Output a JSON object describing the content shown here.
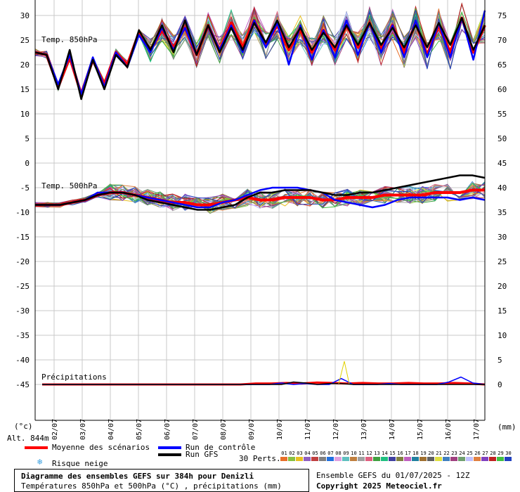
{
  "chart_data": {
    "type": "line",
    "title": "Diagramme des ensembles GEFS sur 384h pour Denizli",
    "subtitle": "Températures 850hPa et 500hPa (°C) , précipitations (mm)",
    "dates": [
      "02/07",
      "03/07",
      "04/07",
      "05/07",
      "06/07",
      "07/07",
      "08/07",
      "09/07",
      "10/07",
      "11/07",
      "12/07",
      "13/07",
      "14/07",
      "15/07",
      "16/07",
      "17/07"
    ],
    "left_axis_ticks": [
      "30",
      "25",
      "20",
      "15",
      "10",
      "5",
      "0",
      "-5",
      "-10",
      "-15",
      "-20",
      "-25",
      "-30",
      "-35",
      "-40",
      "-45"
    ],
    "right_axis_ticks": [
      "75",
      "70",
      "65",
      "60",
      "55",
      "50",
      "45",
      "40",
      "35",
      "30",
      "25",
      "20",
      "15",
      "10",
      "5",
      "0"
    ],
    "left_unit": "(°c)",
    "right_unit": "(mm)",
    "altitude": "Alt. 844m",
    "panels": [
      {
        "label": "Temp. 850hPa",
        "ylim": [
          0,
          33
        ]
      },
      {
        "label": "Temp. 500hPa",
        "ylim": [
          -50,
          0
        ]
      },
      {
        "label": "Précipitations",
        "ylim": [
          0,
          45
        ]
      }
    ],
    "series": [
      {
        "name": "Moyenne des scénarios",
        "color": "#ff0000",
        "t850": [
          22.5,
          22,
          15.5,
          21.5,
          14,
          21,
          16,
          22.5,
          20,
          26.5,
          23,
          27,
          23.5,
          27.5,
          22,
          28,
          23,
          28.5,
          23.5,
          29,
          24,
          28,
          23,
          27,
          22.5,
          27,
          23,
          28,
          23.5,
          28.5,
          23,
          28,
          22.5,
          28.5,
          22,
          28,
          22.5,
          29.5,
          22.5,
          28
        ],
        "t500": [
          -8.5,
          -8.5,
          -8.5,
          -8,
          -7.5,
          -6.5,
          -6,
          -6,
          -6.5,
          -7,
          -7.5,
          -8,
          -8,
          -8.5,
          -8.5,
          -8,
          -7.5,
          -7,
          -7.5,
          -7.5,
          -7,
          -7,
          -7,
          -7.5,
          -7.5,
          -7,
          -7,
          -7,
          -6.5,
          -6.5,
          -6.5,
          -6.5,
          -6,
          -6,
          -6,
          -5.5,
          -5.5
        ],
        "precip": [
          0,
          0,
          0,
          0,
          0,
          0,
          0,
          0,
          0,
          0,
          0,
          0,
          0,
          0,
          0.2,
          0.2,
          0.3,
          0.2,
          0.4,
          0.3,
          0.2,
          0.3,
          0.2,
          0.2,
          0.3,
          0.2,
          0.2,
          0.3,
          0.2,
          0
        ]
      },
      {
        "name": "Run de contrôle",
        "color": "#0000ff",
        "t850": [
          22.5,
          22,
          16,
          22,
          14,
          21.5,
          15.5,
          22.5,
          19.5,
          26,
          22.5,
          27.5,
          23,
          27.5,
          22,
          28,
          23,
          28,
          22.5,
          29,
          23.5,
          28.5,
          20,
          28,
          21,
          27,
          21.5,
          29,
          22,
          28.5,
          22.5,
          28,
          21.5,
          29,
          21.5,
          28.5,
          21.5,
          29.5,
          21,
          31
        ],
        "t500": [
          -8.5,
          -8.5,
          -8.5,
          -8,
          -7.5,
          -6,
          -6,
          -6,
          -6.5,
          -7,
          -7.5,
          -8,
          -8.5,
          -9,
          -9,
          -8,
          -7.5,
          -6.5,
          -5.5,
          -5,
          -5,
          -5,
          -5.5,
          -6,
          -7.5,
          -8,
          -8.5,
          -9,
          -8.5,
          -7.5,
          -7,
          -7,
          -7,
          -7,
          -7.5,
          -7,
          -7.5
        ],
        "precip": [
          0,
          0,
          0,
          0,
          0,
          0,
          0,
          0,
          0,
          0,
          0,
          0,
          0,
          0,
          0,
          0,
          0,
          0,
          0,
          0,
          0.3,
          0,
          0.2,
          0,
          0,
          1.2,
          0,
          0,
          0,
          0.2,
          0,
          0,
          0,
          0,
          0.5,
          1.5,
          0.3,
          0
        ]
      },
      {
        "name": "Run GFS",
        "color": "#000000",
        "t850": [
          22.5,
          22,
          15,
          23,
          13,
          21,
          15,
          22,
          19.5,
          27,
          23,
          28,
          22.5,
          29,
          22,
          28,
          22.5,
          27.5,
          23,
          28.5,
          24.5,
          29,
          23.5,
          27.5,
          23,
          26.5,
          23.5,
          28,
          24,
          28.5,
          24,
          27.5,
          23.5,
          28,
          23.5,
          28.5,
          24,
          29.5,
          23,
          28
        ],
        "t500": [
          -8.5,
          -8.5,
          -8.5,
          -8,
          -7.5,
          -6.5,
          -6,
          -6,
          -6.5,
          -7.5,
          -8,
          -8.5,
          -9,
          -9.5,
          -9.5,
          -9,
          -8.5,
          -7,
          -6,
          -6,
          -5.5,
          -5.5,
          -5.5,
          -6,
          -6.5,
          -6.5,
          -6,
          -6,
          -5.5,
          -5,
          -4.5,
          -4,
          -3.5,
          -3,
          -2.5,
          -2.5,
          -3
        ],
        "precip": [
          0,
          0,
          0,
          0,
          0,
          0,
          0,
          0,
          0,
          0,
          0,
          0,
          0,
          0,
          0,
          0,
          0,
          0,
          0,
          0,
          0,
          0.5,
          0.3,
          0,
          0.2,
          0.2,
          0,
          0,
          0,
          0,
          0,
          0,
          0,
          0,
          0,
          0,
          0,
          0
        ]
      }
    ]
  },
  "legend": {
    "mean_label": "Moyenne des scénarios",
    "mean_color": "#ff0000",
    "control_label": "Run de contrôle",
    "control_color": "#0000ff",
    "gfs_label": "Run GFS",
    "gfs_color": "#000000",
    "snow_label": "Risque neige",
    "snow_icon": "snowflake-icon",
    "perts_label": "30 Perts.",
    "pert_numbers": [
      "01",
      "02",
      "03",
      "04",
      "05",
      "06",
      "07",
      "08",
      "09",
      "10",
      "11",
      "12",
      "13",
      "14",
      "15",
      "16",
      "17",
      "18",
      "19",
      "20",
      "21",
      "22",
      "23",
      "24",
      "25",
      "26",
      "27",
      "28",
      "29",
      "30"
    ],
    "pert_colors": [
      "#e8702a",
      "#88c040",
      "#e8c020",
      "#9060c0",
      "#c04040",
      "#808080",
      "#2070e0",
      "#e0a0e0",
      "#60c0c0",
      "#c08040",
      "#a0a0a0",
      "#e06080",
      "#40a040",
      "#20c080",
      "#4040a0",
      "#808040",
      "#c060c0",
      "#2080a0",
      "#a07030",
      "#606060",
      "#e0e040",
      "#4080c0",
      "#a04080",
      "#70a070",
      "#c0c0ff",
      "#e08040",
      "#8040c0",
      "#c02020",
      "#40c040",
      "#2040c0"
    ]
  },
  "footer": {
    "title": "Diagramme des ensembles GEFS sur 384h pour Denizli",
    "subtitle": "Températures 850hPa et 500hPa (°C) , précipitations (mm)",
    "run_info": "Ensemble GEFS du 01/07/2025 - 12Z",
    "copyright": "Copyright 2025 Meteociel.fr"
  }
}
